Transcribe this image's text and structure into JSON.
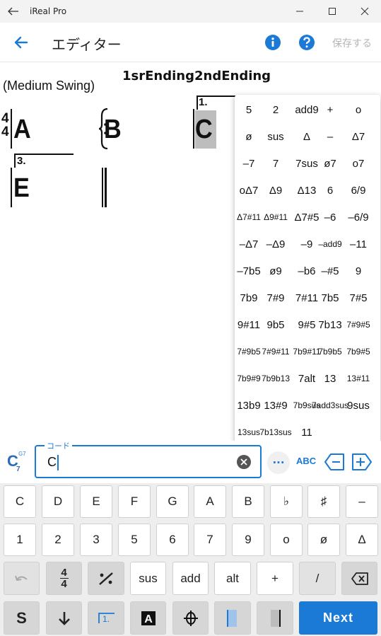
{
  "window": {
    "title": "iReal Pro"
  },
  "header": {
    "title": "エディター",
    "save_label": "保存する"
  },
  "score": {
    "song_title": "1srEnding2ndEnding",
    "style": "(Medium Swing)",
    "time_signature": {
      "top": "4",
      "bottom": "4"
    },
    "chords": [
      "A",
      "B",
      "C",
      "E"
    ],
    "ending_labels": [
      "1.",
      "3."
    ]
  },
  "extensions_popup": {
    "rows": [
      [
        "5",
        "2",
        "add9",
        "+",
        "o"
      ],
      [
        "ø",
        "sus",
        "Δ",
        "–",
        "Δ7"
      ],
      [
        "–7",
        "7",
        "7sus",
        "ø7",
        "o7"
      ],
      [
        "oΔ7",
        "Δ9",
        "Δ13",
        "6",
        "6/9"
      ],
      [
        "Δ7#11",
        "Δ9#11",
        "Δ7#5",
        "–6",
        "–6/9"
      ],
      [
        "–Δ7",
        "–Δ9",
        "–9",
        "–add9",
        "–11"
      ],
      [
        "–7b5",
        "ø9",
        "–b6",
        "–#5",
        "9"
      ],
      [
        "7b9",
        "7#9",
        "7#11",
        "7b5",
        "7#5"
      ],
      [
        "9#11",
        "9b5",
        "9#5",
        "7b13",
        "7#9#5"
      ],
      [
        "7#9b5",
        "7#9#11",
        "7b9#11",
        "7b9b5",
        "7b9#5"
      ],
      [
        "7b9#9",
        "7b9b13",
        "7alt",
        "13",
        "13#11"
      ],
      [
        "13b9",
        "13#9",
        "7b9sus",
        "7add3sus",
        "9sus"
      ],
      [
        "13sus",
        "7b13sus",
        "11"
      ]
    ]
  },
  "entry": {
    "preview_root": "C",
    "preview_sub": "7",
    "preview_alt": "G7",
    "field_label": "コード",
    "field_value": "C",
    "more_label": "···",
    "abc_label": "ABC"
  },
  "keyboard": {
    "row1": [
      "C",
      "D",
      "E",
      "F",
      "G",
      "A",
      "B",
      "♭",
      "♯",
      "–"
    ],
    "row2": [
      "1",
      "2",
      "3",
      "5",
      "6",
      "7",
      "9",
      "o",
      "ø",
      "Δ"
    ],
    "row3": [
      "4/4",
      "sus",
      "add",
      "alt",
      "+",
      "/"
    ],
    "row4_s": "S",
    "row4_coda": "𝄌",
    "next_label": "Next"
  },
  "colors": {
    "accent": "#1a7ad6",
    "save_disabled": "#b5b5b5",
    "highlight": "#bdbdbd"
  }
}
